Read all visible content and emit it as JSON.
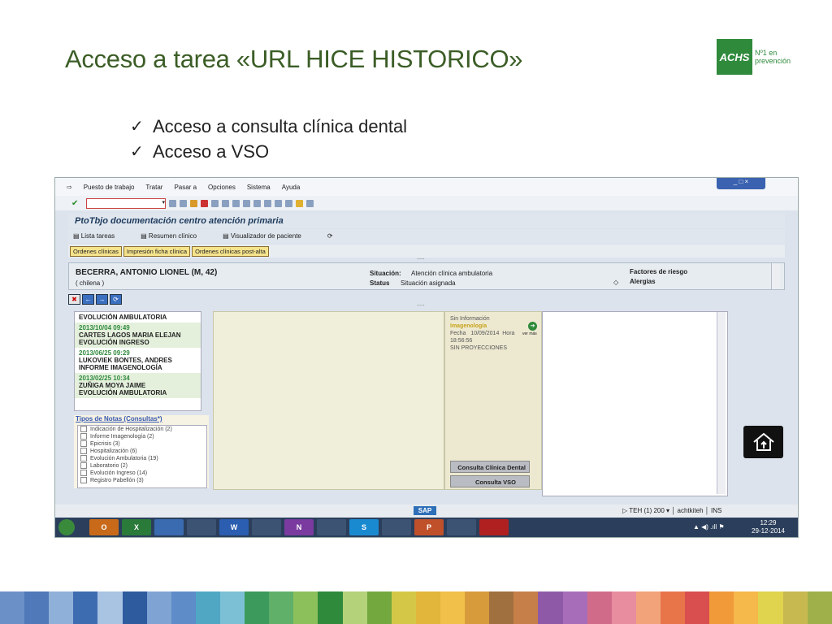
{
  "slide": {
    "title": "Acceso a tarea «URL HICE HISTORICO»",
    "bullets": [
      "Acceso a consulta clínica dental",
      "Acceso a VSO"
    ],
    "logo": {
      "brand": "ACHS",
      "tagline_1": "Nº1 en",
      "tagline_2": "prevención"
    }
  },
  "sap": {
    "menu": [
      "Puesto de trabajo",
      "Tratar",
      "Pasar a",
      "Opciones",
      "Sistema",
      "Ayuda"
    ],
    "transaction_title": "PtoTbjo documentación centro atención primaria",
    "app_tools": [
      "Lista tareas",
      "Resumen clínico",
      "Visualizador de paciente"
    ],
    "tabs": [
      "Ordenes clínicas",
      "Impresión ficha clínica",
      "Ordenes clínicas post-alta"
    ],
    "dots": ".....",
    "patient": {
      "name": "BECERRA, ANTONIO LIONEL (M, 42)",
      "nationality": "( chilena )",
      "situacion_label": "Situación:",
      "situacion_value": "Atención clínica ambulatoria",
      "status_label": "Status",
      "status_value": "Situación asignada",
      "factores_label": "Factores de riesgo",
      "alergias_label": "Alergias"
    },
    "history": [
      {
        "date": "",
        "name": "",
        "type": "EVOLUCIÓN AMBULATORIA"
      },
      {
        "date": "2013/10/04 09:49",
        "name": "CARTES LAGOS MARIA ELEJAN",
        "type": "EVOLUCIÓN INGRESO"
      },
      {
        "date": "2013/06/25 09:29",
        "name": "LUKOVIEK BONTES, ANDRES",
        "type": "INFORME IMAGENOLOGÍA"
      },
      {
        "date": "2013/02/25 10:34",
        "name": "ZUÑIGA MOYA JAIME",
        "type": "EVOLUCIÓN AMBULATORIA"
      }
    ],
    "notes_title": "Tipos de Notas (Consultas*)",
    "notes": [
      "Indicación de Hospitalización (2)",
      "Informe Imagenología (2)",
      "Epicrisis (3)",
      "Hospitalización (6)",
      "Evolución Ambulatoria (19)",
      "Laboratorio (2)",
      "Evolución Ingreso (14)",
      "Registro Pabellón (3)"
    ],
    "detail": {
      "sin_info": "Sin Información",
      "imagenologia": "Imagenología",
      "fecha_label": "Fecha",
      "fecha_value": "10/09/2014",
      "hora_label": "Hora",
      "ver_mas": "ver más",
      "time": "18:56:56",
      "proyecciones": "SIN PROYECCIONES"
    },
    "buttons": {
      "dental": "Consulta Clínica Dental",
      "vso": "Consulta VSO"
    },
    "status_bar": {
      "system": "TEH (1) 200",
      "host": "achtkiteh",
      "mode": "INS",
      "sap": "SAP"
    },
    "taskbar": {
      "apps": [
        "O",
        "X",
        "",
        "",
        "W",
        "",
        "N",
        "",
        "S",
        "",
        "P",
        "",
        ""
      ],
      "time": "12:29",
      "date": "29-12-2014"
    }
  },
  "colors": {
    "title": "#3b5d26",
    "brand": "#2f8a3c",
    "stripes": [
      "#6b8fc7",
      "#4f79b8",
      "#8fb0d8",
      "#3e6cb0",
      "#a9c3e3",
      "#2e5a9e",
      "#7fa4d4",
      "#5e8cc8",
      "#4fa7c4",
      "#7cc0d6",
      "#3c9a5c",
      "#60b06a",
      "#8cc05a",
      "#2f8a3c",
      "#b4d27a",
      "#73a83e",
      "#d4c748",
      "#e2b63a",
      "#f0c04a",
      "#d89b3c",
      "#a0703e",
      "#c77f4a",
      "#8e5aa8",
      "#a86db8",
      "#d06c8a",
      "#e88ca0",
      "#f2a37a",
      "#e8744a",
      "#d94f4f",
      "#f09a3a",
      "#f5b84a",
      "#e0d34d",
      "#c8b850",
      "#9fb04a"
    ]
  }
}
